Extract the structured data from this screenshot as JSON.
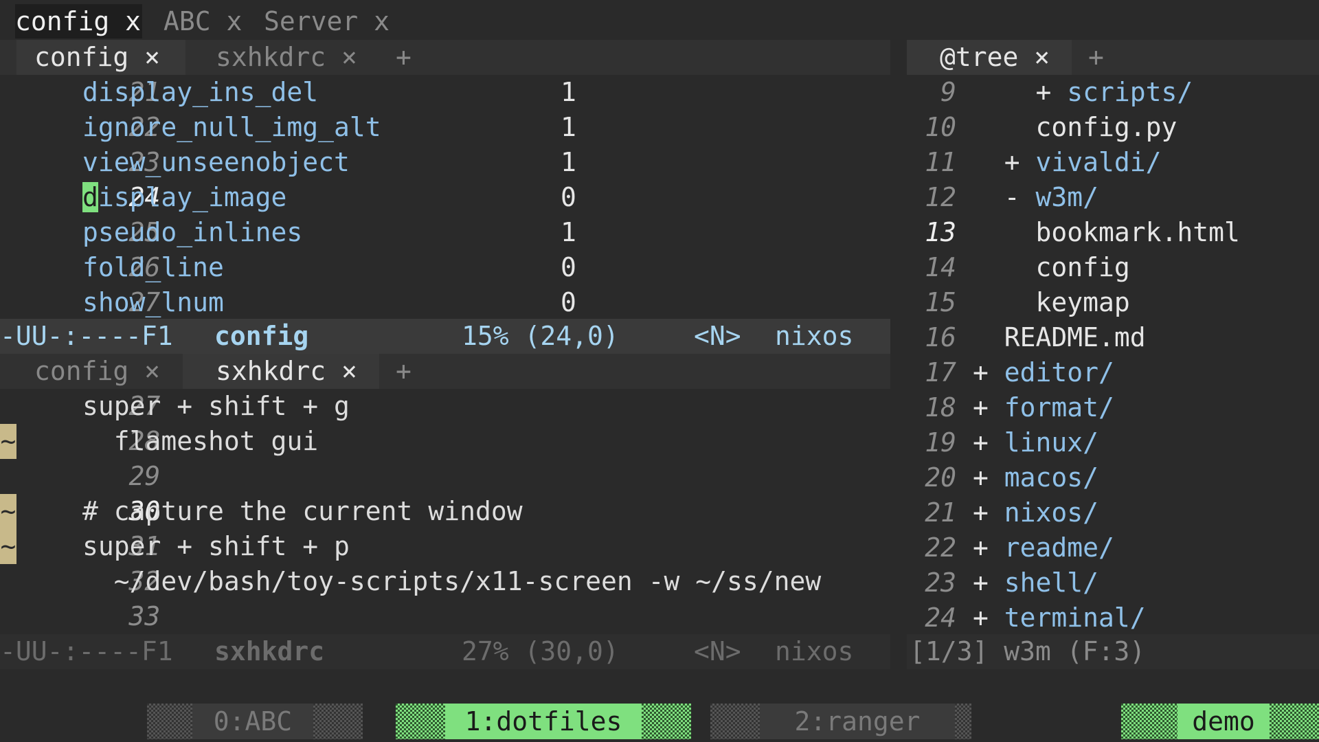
{
  "frame_tabs": [
    "config x",
    "ABC x",
    "Server x"
  ],
  "top_pane": {
    "tabs": [
      {
        "label": "config ×",
        "active": true
      },
      {
        "label": "sxhkdrc ×",
        "active": false
      }
    ],
    "plus": "+",
    "lines": [
      {
        "num": "21",
        "key": "display_ins_del",
        "value": "1"
      },
      {
        "num": "22",
        "key": "ignore_null_img_alt",
        "value": "1"
      },
      {
        "num": "23",
        "key": "view_unseenobject",
        "value": "1"
      },
      {
        "num": "24",
        "cursor_char": "d",
        "key": "isplay_image",
        "value": "0"
      },
      {
        "num": "25",
        "key": "pseudo_inlines",
        "value": "1"
      },
      {
        "num": "26",
        "key": "fold_line",
        "value": "0"
      },
      {
        "num": "27",
        "key": "show_lnum",
        "value": "0"
      }
    ],
    "modeline": {
      "state": "-UU-:----F1",
      "buffer": "config",
      "position": "15% (24,0)",
      "mode": "<N>",
      "host": "nixos"
    }
  },
  "bottom_pane": {
    "tabs": [
      {
        "label": "config ×",
        "active": false
      },
      {
        "label": "sxhkdrc ×",
        "active": true
      }
    ],
    "plus": "+",
    "lines": [
      {
        "num": "27",
        "text": "super + shift + g",
        "mark": ""
      },
      {
        "num": "28",
        "text": "  flameshot gui",
        "mark": "~"
      },
      {
        "num": "29",
        "text": "",
        "mark": ""
      },
      {
        "num": "30",
        "text": "# capture the current window",
        "mark": "~"
      },
      {
        "num": "31",
        "text": "super + shift + p",
        "mark": "~"
      },
      {
        "num": "32",
        "text": "  ~/dev/bash/toy-scripts/x11-screen -w ~/ss/new",
        "mark": ""
      },
      {
        "num": "33",
        "text": "",
        "mark": ""
      }
    ],
    "modeline": {
      "state": "-UU-:----F1",
      "buffer": "sxhkdrc",
      "position": "27% (30,0)",
      "mode": "<N>",
      "host": "nixos"
    }
  },
  "tree_pane": {
    "tab": "@tree ×",
    "plus": "+",
    "lines": [
      {
        "num": "9",
        "prefix": "    + ",
        "name": "scripts/",
        "dir": true
      },
      {
        "num": "10",
        "prefix": "    ",
        "name": "config.py",
        "dir": false
      },
      {
        "num": "11",
        "prefix": "  + ",
        "name": "vivaldi/",
        "dir": true
      },
      {
        "num": "12",
        "prefix": "  - ",
        "name": "w3m/",
        "dir": true
      },
      {
        "num": "13",
        "prefix": "    ",
        "name": "bookmark.html",
        "dir": false
      },
      {
        "num": "14",
        "prefix": "    ",
        "name": "config",
        "dir": false
      },
      {
        "num": "15",
        "prefix": "    ",
        "name": "keymap",
        "dir": false
      },
      {
        "num": "16",
        "prefix": "  ",
        "name": "README.md",
        "dir": false
      },
      {
        "num": "17",
        "prefix": "+ ",
        "name": "editor/",
        "dir": true
      },
      {
        "num": "18",
        "prefix": "+ ",
        "name": "format/",
        "dir": true
      },
      {
        "num": "19",
        "prefix": "+ ",
        "name": "linux/",
        "dir": true
      },
      {
        "num": "20",
        "prefix": "+ ",
        "name": "macos/",
        "dir": true
      },
      {
        "num": "21",
        "prefix": "+ ",
        "name": "nixos/",
        "dir": true
      },
      {
        "num": "22",
        "prefix": "+ ",
        "name": "readme/",
        "dir": true
      },
      {
        "num": "23",
        "prefix": "+ ",
        "name": "shell/",
        "dir": true
      },
      {
        "num": "24",
        "prefix": "+ ",
        "name": "terminal/",
        "dir": true
      }
    ],
    "modeline": "[1/3] w3m (F:3)"
  },
  "tmux": {
    "windows": [
      "0:ABC",
      "1:dotfiles",
      "2:ranger"
    ],
    "active_index": 1,
    "session": "demo"
  },
  "colors": {
    "background": "#2a2a2a",
    "keyword_blue": "#8fc0e8",
    "cursor_green": "#7fe07f",
    "git_mark": "#c8b98a"
  }
}
